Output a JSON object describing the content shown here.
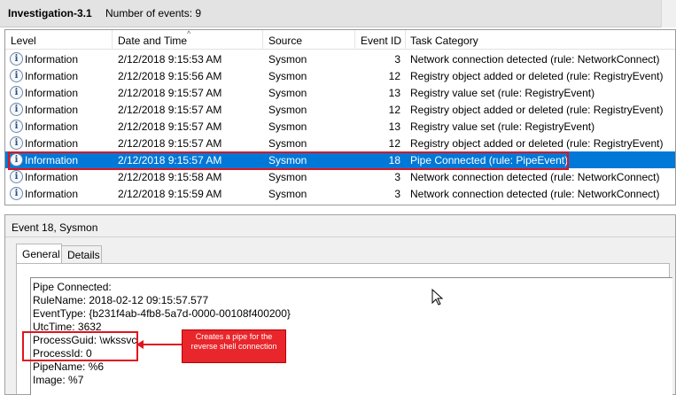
{
  "window": {
    "title": "Investigation-3.1",
    "event_count": "Number of events: 9"
  },
  "columns": {
    "level": "Level",
    "date": "Date and Time",
    "source": "Source",
    "event_id": "Event ID",
    "task": "Task Category"
  },
  "events": [
    {
      "level": "Information",
      "date": "2/12/2018 9:15:53 AM",
      "source": "Sysmon",
      "event_id": "3",
      "task": "Network connection detected (rule: NetworkConnect)"
    },
    {
      "level": "Information",
      "date": "2/12/2018 9:15:56 AM",
      "source": "Sysmon",
      "event_id": "12",
      "task": "Registry object added or deleted (rule: RegistryEvent)"
    },
    {
      "level": "Information",
      "date": "2/12/2018 9:15:57 AM",
      "source": "Sysmon",
      "event_id": "13",
      "task": "Registry value set (rule: RegistryEvent)"
    },
    {
      "level": "Information",
      "date": "2/12/2018 9:15:57 AM",
      "source": "Sysmon",
      "event_id": "12",
      "task": "Registry object added or deleted (rule: RegistryEvent)"
    },
    {
      "level": "Information",
      "date": "2/12/2018 9:15:57 AM",
      "source": "Sysmon",
      "event_id": "13",
      "task": "Registry value set (rule: RegistryEvent)"
    },
    {
      "level": "Information",
      "date": "2/12/2018 9:15:57 AM",
      "source": "Sysmon",
      "event_id": "12",
      "task": "Registry object added or deleted (rule: RegistryEvent)"
    },
    {
      "level": "Information",
      "date": "2/12/2018 9:15:57 AM",
      "source": "Sysmon",
      "event_id": "18",
      "task": "Pipe Connected (rule: PipeEvent)"
    },
    {
      "level": "Information",
      "date": "2/12/2018 9:15:58 AM",
      "source": "Sysmon",
      "event_id": "3",
      "task": "Network connection detected (rule: NetworkConnect)"
    },
    {
      "level": "Information",
      "date": "2/12/2018 9:15:59 AM",
      "source": "Sysmon",
      "event_id": "3",
      "task": "Network connection detected (rule: NetworkConnect)"
    }
  ],
  "selected_index": 6,
  "info_icon_glyph": "i",
  "detail": {
    "title": "Event 18, Sysmon",
    "tab_general": "General",
    "tab_details": "Details",
    "lines": [
      "Pipe Connected:",
      "RuleName: 2018-02-12 09:15:57.577",
      "EventType: {b231f4ab-4fb8-5a7d-0000-00108f400200}",
      "UtcTime: 3632",
      "ProcessGuid: \\wkssvc",
      "ProcessId: 0",
      "PipeName: %6",
      "Image: %7"
    ]
  },
  "annotation": {
    "callout_text": "Creates a pipe for the reverse shell connection",
    "color": "#e0141e"
  },
  "colors": {
    "selection": "#0078d7",
    "highlight": "#e0141e"
  }
}
